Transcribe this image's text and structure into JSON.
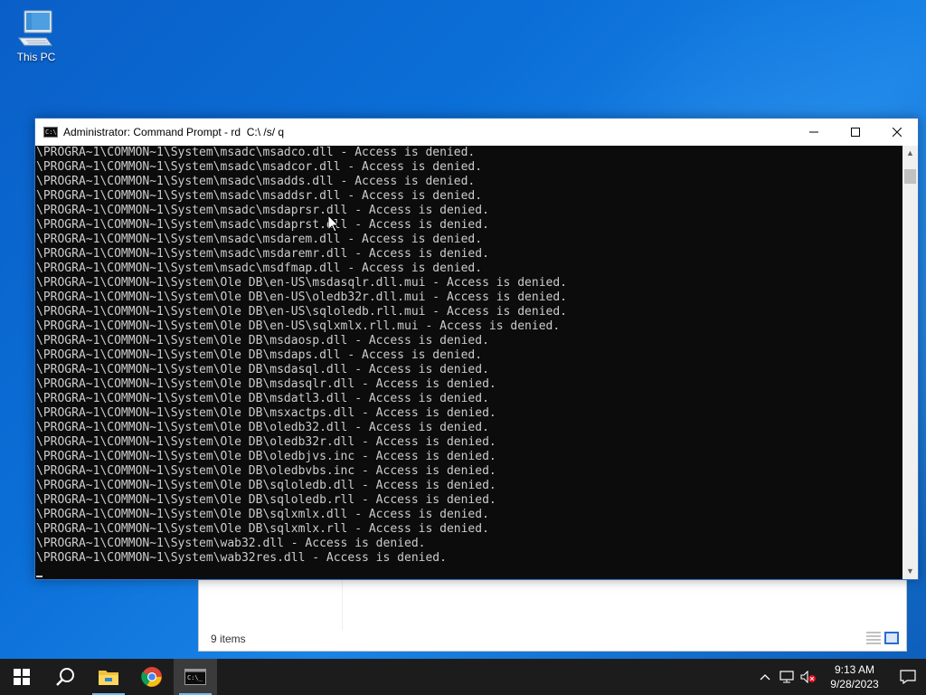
{
  "desktop": {
    "icons": [
      {
        "label": "This PC",
        "icon": "computer-icon"
      }
    ]
  },
  "explorer": {
    "status": "9 items",
    "view_buttons": [
      "details-view-icon",
      "large-icons-view-icon"
    ]
  },
  "cmd": {
    "title": "Administrator: Command Prompt - rd  C:\\ /s/ q",
    "controls": {
      "minimize": "—",
      "maximize": "☐",
      "close": "✕"
    },
    "lines": [
      "\\PROGRA~1\\COMMON~1\\System\\msadc\\msadco.dll - Access is denied.",
      "\\PROGRA~1\\COMMON~1\\System\\msadc\\msadcor.dll - Access is denied.",
      "\\PROGRA~1\\COMMON~1\\System\\msadc\\msadds.dll - Access is denied.",
      "\\PROGRA~1\\COMMON~1\\System\\msadc\\msaddsr.dll - Access is denied.",
      "\\PROGRA~1\\COMMON~1\\System\\msadc\\msdaprsr.dll - Access is denied.",
      "\\PROGRA~1\\COMMON~1\\System\\msadc\\msdaprst.dll - Access is denied.",
      "\\PROGRA~1\\COMMON~1\\System\\msadc\\msdarem.dll - Access is denied.",
      "\\PROGRA~1\\COMMON~1\\System\\msadc\\msdaremr.dll - Access is denied.",
      "\\PROGRA~1\\COMMON~1\\System\\msadc\\msdfmap.dll - Access is denied.",
      "\\PROGRA~1\\COMMON~1\\System\\Ole DB\\en-US\\msdasqlr.dll.mui - Access is denied.",
      "\\PROGRA~1\\COMMON~1\\System\\Ole DB\\en-US\\oledb32r.dll.mui - Access is denied.",
      "\\PROGRA~1\\COMMON~1\\System\\Ole DB\\en-US\\sqloledb.rll.mui - Access is denied.",
      "\\PROGRA~1\\COMMON~1\\System\\Ole DB\\en-US\\sqlxmlx.rll.mui - Access is denied.",
      "\\PROGRA~1\\COMMON~1\\System\\Ole DB\\msdaosp.dll - Access is denied.",
      "\\PROGRA~1\\COMMON~1\\System\\Ole DB\\msdaps.dll - Access is denied.",
      "\\PROGRA~1\\COMMON~1\\System\\Ole DB\\msdasql.dll - Access is denied.",
      "\\PROGRA~1\\COMMON~1\\System\\Ole DB\\msdasqlr.dll - Access is denied.",
      "\\PROGRA~1\\COMMON~1\\System\\Ole DB\\msdatl3.dll - Access is denied.",
      "\\PROGRA~1\\COMMON~1\\System\\Ole DB\\msxactps.dll - Access is denied.",
      "\\PROGRA~1\\COMMON~1\\System\\Ole DB\\oledb32.dll - Access is denied.",
      "\\PROGRA~1\\COMMON~1\\System\\Ole DB\\oledb32r.dll - Access is denied.",
      "\\PROGRA~1\\COMMON~1\\System\\Ole DB\\oledbjvs.inc - Access is denied.",
      "\\PROGRA~1\\COMMON~1\\System\\Ole DB\\oledbvbs.inc - Access is denied.",
      "\\PROGRA~1\\COMMON~1\\System\\Ole DB\\sqloledb.dll - Access is denied.",
      "\\PROGRA~1\\COMMON~1\\System\\Ole DB\\sqloledb.rll - Access is denied.",
      "\\PROGRA~1\\COMMON~1\\System\\Ole DB\\sqlxmlx.dll - Access is denied.",
      "\\PROGRA~1\\COMMON~1\\System\\Ole DB\\sqlxmlx.rll - Access is denied.",
      "\\PROGRA~1\\COMMON~1\\System\\wab32.dll - Access is denied.",
      "\\PROGRA~1\\COMMON~1\\System\\wab32res.dll - Access is denied."
    ],
    "console_fg": "#cccccc",
    "console_bg": "#0c0c0c"
  },
  "taskbar": {
    "items": [
      "start-icon",
      "search-icon",
      "file-explorer-icon",
      "chrome-icon",
      "command-prompt-icon"
    ],
    "tray": [
      "chevron-up-icon",
      "network-icon",
      "volume-muted-icon"
    ],
    "time": "9:13 AM",
    "date": "9/28/2023",
    "accent": "#76b9ed"
  }
}
